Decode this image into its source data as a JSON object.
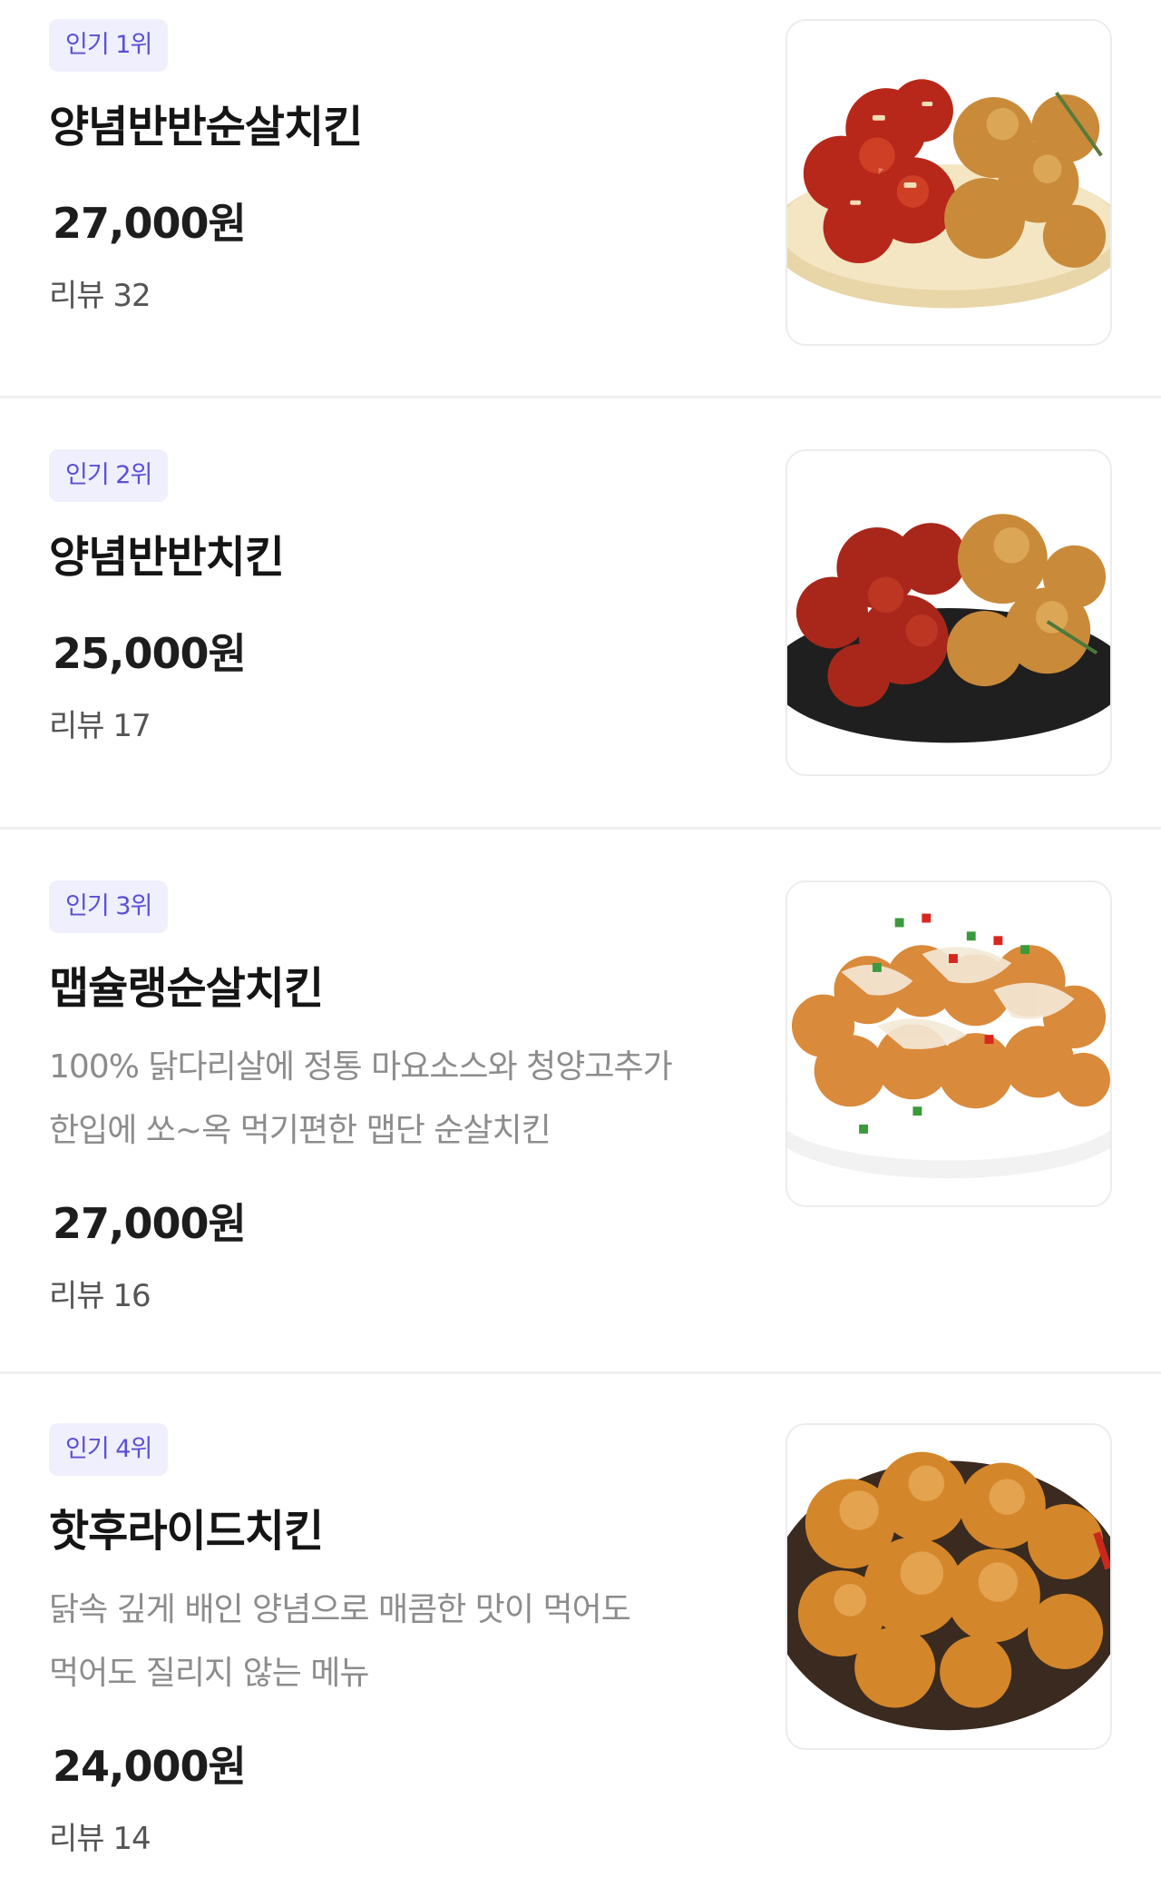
{
  "menu": {
    "items": [
      {
        "rank_badge": "인기 1위",
        "name": "양념반반순살치킨",
        "description": "",
        "description_line2": "",
        "price": "27,000원",
        "reviews": "리뷰 32",
        "image": "chicken-half-half-boneless-photo"
      },
      {
        "rank_badge": "인기 2위",
        "name": "양념반반치킨",
        "description": "",
        "description_line2": "",
        "price": "25,000원",
        "reviews": "리뷰 17",
        "image": "chicken-half-half-photo"
      },
      {
        "rank_badge": "인기 3위",
        "name": "맵슐랭순살치킨",
        "description": "100% 닭다리살에 정통 마요소스와 청양고추가",
        "description_line2": "한입에 쏘~옥 먹기편한 맵단 순살치킨",
        "price": "27,000원",
        "reviews": "리뷰 16",
        "image": "mayo-spicy-boneless-chicken-photo"
      },
      {
        "rank_badge": "인기 4위",
        "name": "핫후라이드치킨",
        "description": "닭속 깊게 배인 양념으로 매콤한 맛이 먹어도",
        "description_line2": "먹어도 질리지 않는 메뉴",
        "price": "24,000원",
        "reviews": "리뷰 14",
        "image": "hot-fried-chicken-photo"
      }
    ]
  },
  "colors": {
    "badge_bg": "#f0effd",
    "badge_text": "#5b4fd6",
    "divider": "#f0f0f2",
    "desc_text": "#8c8c8c"
  }
}
